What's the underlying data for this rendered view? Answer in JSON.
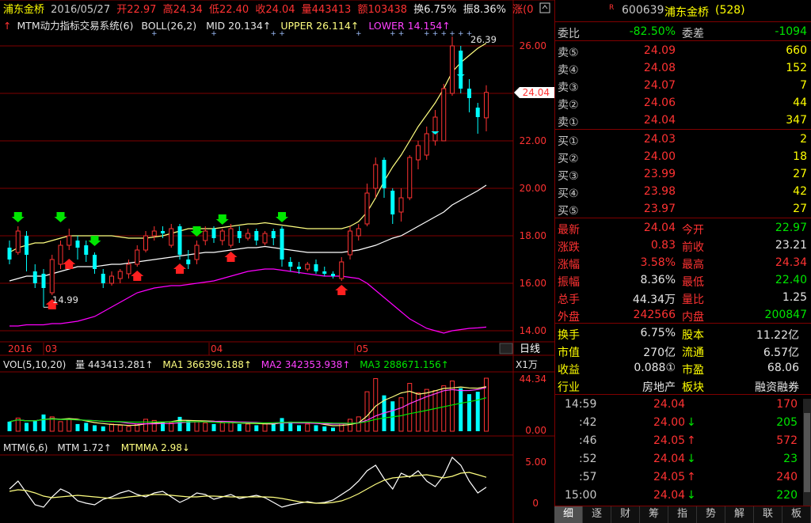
{
  "header": {
    "name": "浦东金桥",
    "date": "2016/05/27",
    "open": "开22.97",
    "high": "高24.34",
    "low": "低22.40",
    "close": "收24.04",
    "vol": "量443413",
    "amt": "额103438",
    "turn": "换6.75%",
    "amp": "振8.36%",
    "chg": "涨(0"
  },
  "indicator_line": {
    "mtm_sys": "MTM动力指标交易系统(6)",
    "boll": "BOLL(26,2)",
    "mid": "MID 20.134↑",
    "upper": "UPPER 26.114↑",
    "lower": "LOWER 14.154↑"
  },
  "price_axis": [
    "26.00",
    "24.00",
    "22.00",
    "20.00",
    "18.00",
    "16.00",
    "14.00"
  ],
  "price_tag": "24.04",
  "annotations": {
    "high": "26.39",
    "low": "14.99"
  },
  "date_axis": [
    "2016",
    "03",
    "04",
    "05"
  ],
  "period_label": "日线",
  "vol_line": {
    "label": "VOL(5,10,20)",
    "v": "量 443413.281↑",
    "ma1": "MA1 366396.188↑",
    "ma2": "MA2 342353.938↑",
    "ma3": "MA3 288671.156↑"
  },
  "vol_unit": "X1万",
  "vol_axis": [
    "44.34",
    "0.00"
  ],
  "mtm_line": {
    "label": "MTM(6,6)",
    "mtm": "MTM 1.72↑",
    "mtmma": "MTMMA 2.98↓"
  },
  "mtm_axis": [
    "5.00",
    "0"
  ],
  "colors": {
    "up": "#ff3232",
    "down": "#00ffff",
    "upper": "#ffff80",
    "mid": "#ffffff",
    "lower": "#ff00ff",
    "grid": "#800000"
  },
  "chart_data": [
    {
      "type": "candlestick",
      "title": "浦东金桥 日线",
      "ylim": [
        14,
        26.8
      ],
      "bars": [
        {
          "o": 17.5,
          "c": 17.0,
          "h": 17.8,
          "l": 16.8
        },
        {
          "o": 17.3,
          "c": 18.2,
          "h": 18.4,
          "l": 17.2
        },
        {
          "o": 18.0,
          "c": 17.2,
          "h": 18.2,
          "l": 16.5
        },
        {
          "o": 16.5,
          "c": 16.0,
          "h": 16.8,
          "l": 15.8
        },
        {
          "o": 16.4,
          "c": 15.8,
          "h": 16.6,
          "l": 14.99
        },
        {
          "o": 15.6,
          "c": 17.0,
          "h": 17.2,
          "l": 15.5
        },
        {
          "o": 16.8,
          "c": 17.6,
          "h": 17.8,
          "l": 16.6
        },
        {
          "o": 17.6,
          "c": 18.0,
          "h": 18.3,
          "l": 17.4
        },
        {
          "o": 17.8,
          "c": 17.5,
          "h": 18.0,
          "l": 17.0
        },
        {
          "o": 17.6,
          "c": 17.2,
          "h": 17.8,
          "l": 16.9
        },
        {
          "o": 17.2,
          "c": 16.6,
          "h": 17.3,
          "l": 16.4
        },
        {
          "o": 16.4,
          "c": 16.0,
          "h": 16.6,
          "l": 15.8
        },
        {
          "o": 16.0,
          "c": 16.3,
          "h": 16.5,
          "l": 15.9
        },
        {
          "o": 16.2,
          "c": 16.5,
          "h": 16.6,
          "l": 16.0
        },
        {
          "o": 16.4,
          "c": 16.8,
          "h": 17.0,
          "l": 16.2
        },
        {
          "o": 16.8,
          "c": 17.4,
          "h": 17.6,
          "l": 16.7
        },
        {
          "o": 17.4,
          "c": 18.0,
          "h": 18.2,
          "l": 17.3
        },
        {
          "o": 18.0,
          "c": 18.2,
          "h": 18.4,
          "l": 17.8
        },
        {
          "o": 18.2,
          "c": 18.1,
          "h": 18.4,
          "l": 17.9
        },
        {
          "o": 17.6,
          "c": 18.3,
          "h": 18.5,
          "l": 17.5
        },
        {
          "o": 18.4,
          "c": 17.2,
          "h": 18.5,
          "l": 17.0
        },
        {
          "o": 17.0,
          "c": 16.8,
          "h": 17.4,
          "l": 16.6
        },
        {
          "o": 17.0,
          "c": 17.6,
          "h": 17.8,
          "l": 16.8
        },
        {
          "o": 17.8,
          "c": 18.2,
          "h": 18.4,
          "l": 17.6
        },
        {
          "o": 18.3,
          "c": 17.9,
          "h": 18.4,
          "l": 17.7
        },
        {
          "o": 17.8,
          "c": 18.2,
          "h": 18.3,
          "l": 17.6
        },
        {
          "o": 17.6,
          "c": 18.3,
          "h": 18.5,
          "l": 17.5
        },
        {
          "o": 18.2,
          "c": 17.9,
          "h": 18.4,
          "l": 17.7
        },
        {
          "o": 17.9,
          "c": 18.1,
          "h": 18.3,
          "l": 17.8
        },
        {
          "o": 18.2,
          "c": 17.8,
          "h": 18.3,
          "l": 17.6
        },
        {
          "o": 17.7,
          "c": 18.1,
          "h": 18.2,
          "l": 17.6
        },
        {
          "o": 18.2,
          "c": 17.9,
          "h": 18.3,
          "l": 17.6
        },
        {
          "o": 18.3,
          "c": 17.0,
          "h": 18.4,
          "l": 16.7
        },
        {
          "o": 16.9,
          "c": 16.7,
          "h": 17.1,
          "l": 16.5
        },
        {
          "o": 16.7,
          "c": 16.6,
          "h": 16.9,
          "l": 16.4
        },
        {
          "o": 16.6,
          "c": 16.8,
          "h": 16.9,
          "l": 16.5
        },
        {
          "o": 16.8,
          "c": 16.5,
          "h": 17.0,
          "l": 16.4
        },
        {
          "o": 16.5,
          "c": 16.4,
          "h": 16.7,
          "l": 16.3
        },
        {
          "o": 16.4,
          "c": 16.3,
          "h": 16.5,
          "l": 16.2
        },
        {
          "o": 16.2,
          "c": 16.9,
          "h": 17.1,
          "l": 16.1
        },
        {
          "o": 17.2,
          "c": 18.2,
          "h": 18.4,
          "l": 17.0
        },
        {
          "o": 18.0,
          "c": 18.3,
          "h": 18.5,
          "l": 17.8
        },
        {
          "o": 18.5,
          "c": 19.8,
          "h": 20.2,
          "l": 18.4
        },
        {
          "o": 20.0,
          "c": 21.0,
          "h": 21.3,
          "l": 19.6
        },
        {
          "o": 21.2,
          "c": 20.0,
          "h": 21.3,
          "l": 19.6
        },
        {
          "o": 19.9,
          "c": 18.9,
          "h": 20.0,
          "l": 18.5
        },
        {
          "o": 19.0,
          "c": 19.6,
          "h": 20.0,
          "l": 18.6
        },
        {
          "o": 19.6,
          "c": 21.3,
          "h": 21.4,
          "l": 19.5
        },
        {
          "o": 21.2,
          "c": 21.8,
          "h": 22.0,
          "l": 20.8
        },
        {
          "o": 21.4,
          "c": 22.3,
          "h": 22.6,
          "l": 21.2
        },
        {
          "o": 22.0,
          "c": 23.0,
          "h": 23.3,
          "l": 21.8
        },
        {
          "o": 22.0,
          "c": 24.2,
          "h": 24.4,
          "l": 22.0
        },
        {
          "o": 24.0,
          "c": 26.0,
          "h": 26.39,
          "l": 23.9
        },
        {
          "o": 25.8,
          "c": 24.2,
          "h": 26.0,
          "l": 24.0
        },
        {
          "o": 24.2,
          "c": 23.8,
          "h": 24.6,
          "l": 23.2
        },
        {
          "o": 23.4,
          "c": 23.0,
          "h": 23.6,
          "l": 22.3
        },
        {
          "o": 22.97,
          "c": 24.04,
          "h": 24.34,
          "l": 22.4
        }
      ],
      "upper": [
        17.3,
        17.5,
        17.6,
        17.7,
        17.7,
        17.8,
        17.9,
        18.0,
        18.0,
        18.0,
        18.0,
        18.0,
        18.0,
        17.95,
        17.9,
        17.9,
        17.9,
        17.95,
        18.0,
        18.1,
        18.2,
        18.3,
        18.3,
        18.3,
        18.3,
        18.35,
        18.4,
        18.45,
        18.5,
        18.5,
        18.55,
        18.5,
        18.45,
        18.4,
        18.35,
        18.3,
        18.3,
        18.3,
        18.3,
        18.3,
        18.4,
        18.6,
        19.0,
        19.6,
        20.3,
        20.9,
        21.4,
        22.0,
        22.6,
        23.1,
        23.6,
        24.2,
        24.9,
        25.3,
        25.6,
        25.9,
        26.114
      ],
      "mid": [
        16.1,
        16.2,
        16.3,
        16.3,
        16.3,
        16.4,
        16.5,
        16.6,
        16.7,
        16.7,
        16.7,
        16.75,
        16.8,
        16.8,
        16.85,
        16.9,
        16.95,
        17.0,
        17.05,
        17.1,
        17.15,
        17.2,
        17.25,
        17.3,
        17.3,
        17.35,
        17.4,
        17.45,
        17.5,
        17.5,
        17.55,
        17.5,
        17.45,
        17.4,
        17.35,
        17.3,
        17.3,
        17.3,
        17.3,
        17.3,
        17.35,
        17.4,
        17.5,
        17.6,
        17.75,
        17.9,
        18.0,
        18.2,
        18.4,
        18.6,
        18.8,
        19.0,
        19.3,
        19.5,
        19.7,
        19.9,
        20.134
      ],
      "lower": [
        14.2,
        14.2,
        14.25,
        14.25,
        14.25,
        14.3,
        14.3,
        14.35,
        14.4,
        14.5,
        14.6,
        14.8,
        15.0,
        15.2,
        15.4,
        15.6,
        15.7,
        15.8,
        15.85,
        15.9,
        15.9,
        15.95,
        16.0,
        16.05,
        16.1,
        16.2,
        16.3,
        16.4,
        16.5,
        16.55,
        16.6,
        16.6,
        16.55,
        16.5,
        16.45,
        16.4,
        16.35,
        16.3,
        16.3,
        16.3,
        16.25,
        16.2,
        16.0,
        15.7,
        15.4,
        15.1,
        14.8,
        14.5,
        14.3,
        14.1,
        14.0,
        13.9,
        14.0,
        14.05,
        14.1,
        14.12,
        14.154
      ]
    },
    {
      "type": "bar",
      "title": "VOL(5,10,20)",
      "ylim": [
        0,
        44.34
      ],
      "values": [
        8,
        11,
        7,
        9,
        14,
        12,
        8,
        10,
        6,
        7,
        5,
        4,
        6,
        5,
        4,
        6,
        10,
        9,
        8,
        7,
        12,
        9,
        8,
        7,
        6,
        7,
        8,
        6,
        6,
        5,
        6,
        7,
        11,
        8,
        5,
        6,
        5,
        4,
        3,
        6,
        10,
        12,
        33,
        44,
        30,
        25,
        28,
        40,
        32,
        35,
        34,
        38,
        42,
        36,
        31,
        33,
        44.34
      ]
    },
    {
      "type": "line",
      "title": "MTM(6,6)",
      "ylim": [
        -1,
        6.5
      ],
      "mtm": [
        1.5,
        2.5,
        1.0,
        -0.5,
        -0.8,
        0.5,
        1.5,
        1.0,
        0.0,
        -0.3,
        -0.5,
        0.2,
        0.5,
        1.0,
        1.3,
        0.8,
        0.5,
        1.0,
        1.2,
        0.5,
        -0.2,
        0.3,
        1.0,
        0.8,
        0.2,
        0.5,
        0.8,
        0.3,
        0.5,
        0.7,
        0.4,
        -0.2,
        -0.8,
        -0.5,
        -0.3,
        -0.1,
        -0.3,
        -0.2,
        0.1,
        0.8,
        1.5,
        2.5,
        3.8,
        4.5,
        2.8,
        1.5,
        3.5,
        3.0,
        3.8,
        2.5,
        1.8,
        3.2,
        5.5,
        4.5,
        2.5,
        1.0,
        1.72
      ],
      "mtmma": [
        1.2,
        1.4,
        1.3,
        1.0,
        0.6,
        0.4,
        0.5,
        0.6,
        0.7,
        0.6,
        0.5,
        0.4,
        0.3,
        0.35,
        0.5,
        0.6,
        0.7,
        0.8,
        0.8,
        0.7,
        0.6,
        0.5,
        0.5,
        0.6,
        0.6,
        0.55,
        0.5,
        0.5,
        0.5,
        0.5,
        0.5,
        0.45,
        0.3,
        0.1,
        -0.1,
        -0.2,
        -0.3,
        -0.3,
        -0.2,
        0.0,
        0.4,
        0.9,
        1.5,
        2.1,
        2.6,
        2.9,
        3.0,
        3.1,
        3.2,
        3.3,
        3.1,
        2.9,
        3.1,
        3.5,
        3.6,
        3.3,
        2.98
      ]
    }
  ],
  "quote": {
    "code": "600639",
    "name": "浦东金桥",
    "sub": "(528)",
    "r_mark": "R",
    "weibi_label": "委比",
    "weibi": "-82.50%",
    "weicha_label": "委差",
    "weicha": "-1094",
    "asks": [
      {
        "label": "卖⑤",
        "price": "24.09",
        "vol": "660"
      },
      {
        "label": "卖④",
        "price": "24.08",
        "vol": "152"
      },
      {
        "label": "卖③",
        "price": "24.07",
        "vol": "7"
      },
      {
        "label": "卖②",
        "price": "24.06",
        "vol": "44"
      },
      {
        "label": "卖①",
        "price": "24.04",
        "vol": "347"
      }
    ],
    "bids": [
      {
        "label": "买①",
        "price": "24.03",
        "vol": "2"
      },
      {
        "label": "买②",
        "price": "24.00",
        "vol": "18"
      },
      {
        "label": "买③",
        "price": "23.99",
        "vol": "27"
      },
      {
        "label": "买④",
        "price": "23.98",
        "vol": "42"
      },
      {
        "label": "买⑤",
        "price": "23.97",
        "vol": "27"
      }
    ],
    "stats": [
      {
        "l1": "最新",
        "v1": "24.04",
        "c1": "r",
        "l2": "今开",
        "v2": "22.97",
        "c2": "g"
      },
      {
        "l1": "涨跌",
        "v1": "0.83",
        "c1": "r",
        "l2": "前收",
        "v2": "23.21",
        "c2": "w"
      },
      {
        "l1": "涨幅",
        "v1": "3.58%",
        "c1": "r",
        "l2": "最高",
        "v2": "24.34",
        "c2": "r"
      },
      {
        "l1": "振幅",
        "v1": "8.36%",
        "c1": "w",
        "l2": "最低",
        "v2": "22.40",
        "c2": "g"
      },
      {
        "l1": "总手",
        "v1": "44.34万",
        "c1": "w",
        "l2": "量比",
        "v2": "1.25",
        "c2": "w"
      },
      {
        "l1": "外盘",
        "v1": "242566",
        "c1": "r",
        "l2": "内盘",
        "v2": "200847",
        "c2": "g"
      }
    ],
    "fund": [
      {
        "l1": "换手",
        "v1": "6.75%",
        "l2": "股本",
        "v2": "11.22亿"
      },
      {
        "l1": "市值",
        "v1": "270亿",
        "l2": "流通",
        "v2": "6.57亿"
      },
      {
        "l1": "收益",
        "v1": "0.088①",
        "l2": "市盈",
        "v2": "68.06"
      },
      {
        "l1": "行业",
        "v1": "房地产",
        "l2": "板块",
        "v2": "融资融券"
      }
    ],
    "ticks": [
      {
        "time": "14:59",
        "price": "24.04",
        "arrow": "",
        "vol": "170",
        "vc": "r"
      },
      {
        "time": ":42",
        "price": "24.00",
        "arrow": "↓",
        "vol": "205",
        "vc": "g"
      },
      {
        "time": ":46",
        "price": "24.05",
        "arrow": "↑",
        "vol": "572",
        "vc": "r"
      },
      {
        "time": ":52",
        "price": "24.04",
        "arrow": "↓",
        "vol": "23",
        "vc": "g"
      },
      {
        "time": ":57",
        "price": "24.05",
        "arrow": "↑",
        "vol": "240",
        "vc": "r"
      },
      {
        "time": "15:00",
        "price": "24.04",
        "arrow": "↓",
        "vol": "220",
        "vc": "g"
      }
    ],
    "tabs": [
      "细",
      "逐",
      "财",
      "筹",
      "指",
      "势",
      "解",
      "联",
      "板"
    ]
  }
}
